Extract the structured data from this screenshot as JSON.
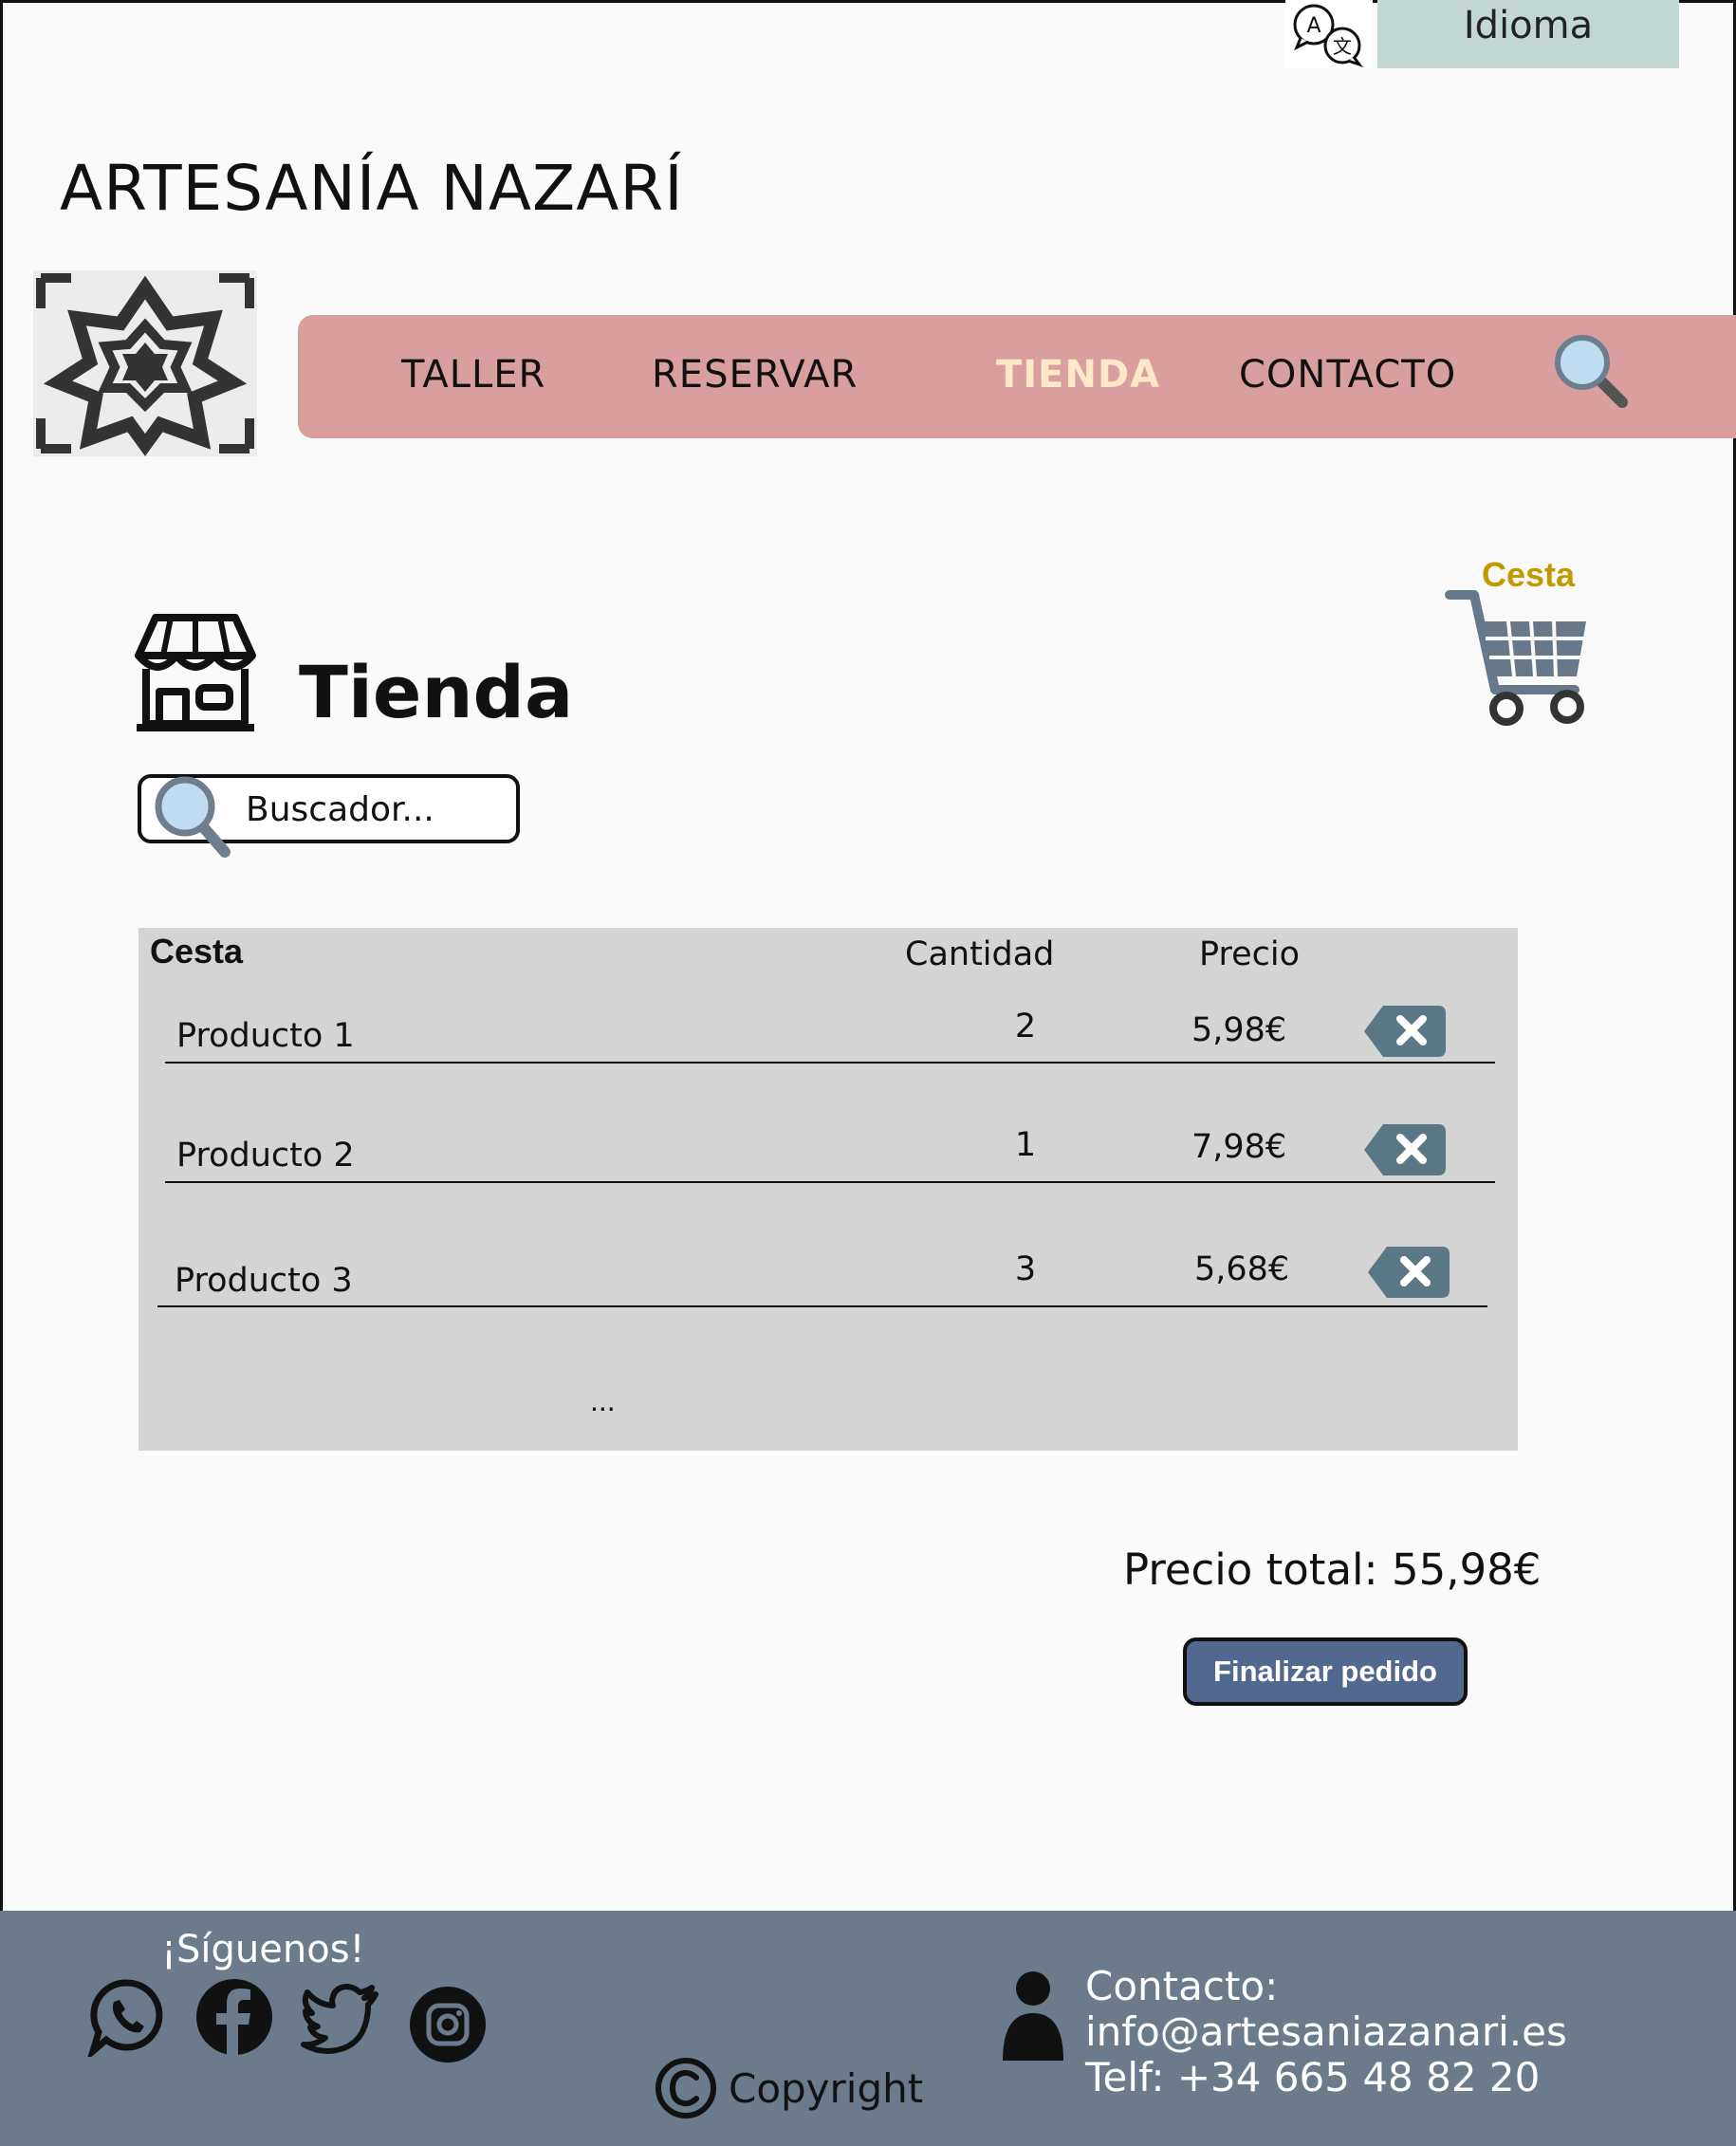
{
  "header": {
    "language_label": "Idioma",
    "site_title": "ARTESANÍA NAZARÍ"
  },
  "nav": {
    "items": [
      {
        "label": "TALLER",
        "active": false
      },
      {
        "label": "RESERVAR",
        "active": false
      },
      {
        "label": "TIENDA",
        "active": true
      },
      {
        "label": "CONTACTO",
        "active": false
      }
    ]
  },
  "cart": {
    "label": "Cesta"
  },
  "page": {
    "title": "Tienda",
    "search_placeholder": "Buscador..."
  },
  "basket": {
    "title": "Cesta",
    "col_quantity": "Cantidad",
    "col_price": "Precio",
    "rows": [
      {
        "name": "Producto 1",
        "quantity": "2",
        "price": "5,98€"
      },
      {
        "name": "Producto 2",
        "quantity": "1",
        "price": "7,98€"
      },
      {
        "name": "Producto 3",
        "quantity": "3",
        "price": "5,68€"
      }
    ],
    "more": "..."
  },
  "summary": {
    "total": "Precio total: 55,98€",
    "finish_label": "Finalizar pedido"
  },
  "footer": {
    "follow": "¡Síguenos!",
    "social": [
      "whatsapp-icon",
      "facebook-icon",
      "twitter-icon",
      "instagram-icon"
    ],
    "copyright": "Copyright",
    "contact_line": "Contacto: info@artesaniazanari.es",
    "phone_line": "Telf: +34 665 48 82 20"
  },
  "colors": {
    "nav_bg": "#d99e9e",
    "nav_active": "#fde9c8",
    "basket_bg": "#d4d4d4",
    "button_bg": "#51698f",
    "footer_bg": "#6b7b8b",
    "cart_label": "#c29a00",
    "language_bg": "#c2d6d4"
  }
}
